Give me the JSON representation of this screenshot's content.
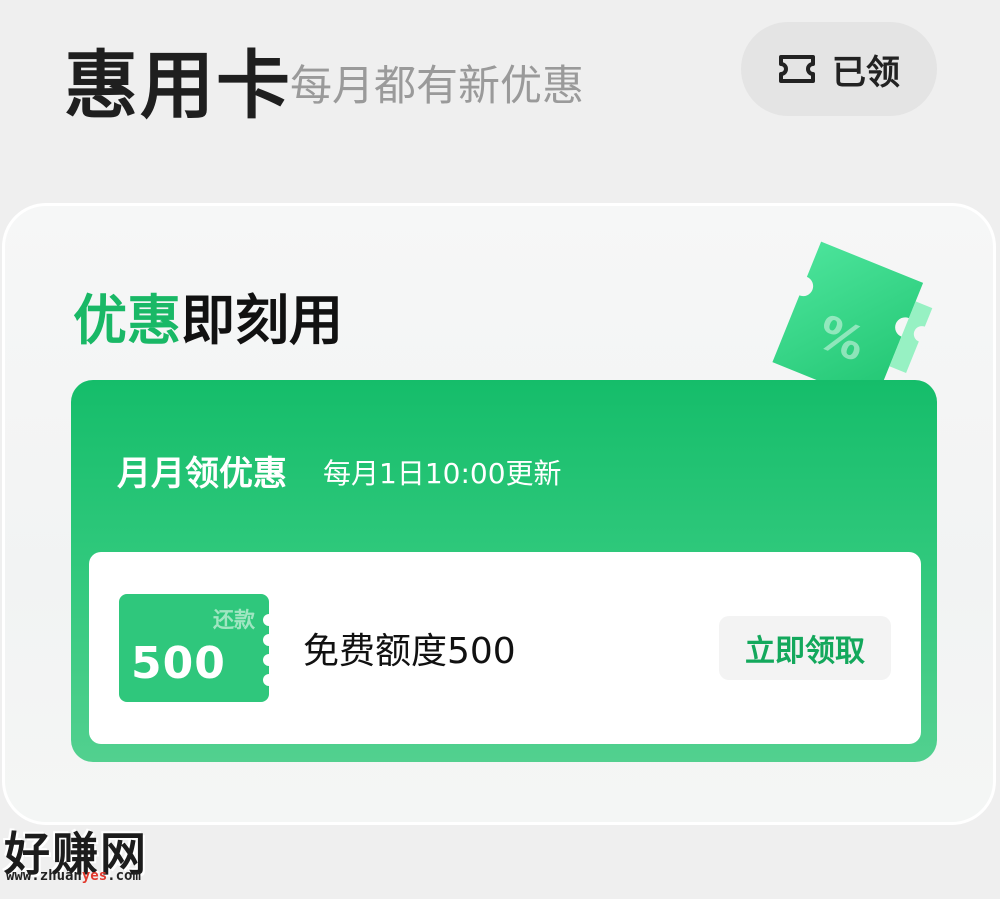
{
  "header": {
    "title": "惠用卡",
    "subtitle": "每月都有新优惠",
    "claimed_label": "已领",
    "claimed_icon": "ticket-icon"
  },
  "panel": {
    "title_green": "优惠",
    "title_dark": "即刻用",
    "card": {
      "heading": "月月领优惠",
      "sub": "每月1日10:00更新",
      "offer": {
        "voucher_tag": "还款",
        "voucher_amount": "500",
        "text": "免费额度500",
        "button": "立即领取"
      }
    }
  },
  "watermark": {
    "main": "好赚网",
    "url_a": "www.zhuan",
    "url_b": "yes",
    "url_c": ".com"
  },
  "colors": {
    "accent": "#19b866",
    "card_top": "#15bd6a",
    "button_text": "#13a85c"
  }
}
